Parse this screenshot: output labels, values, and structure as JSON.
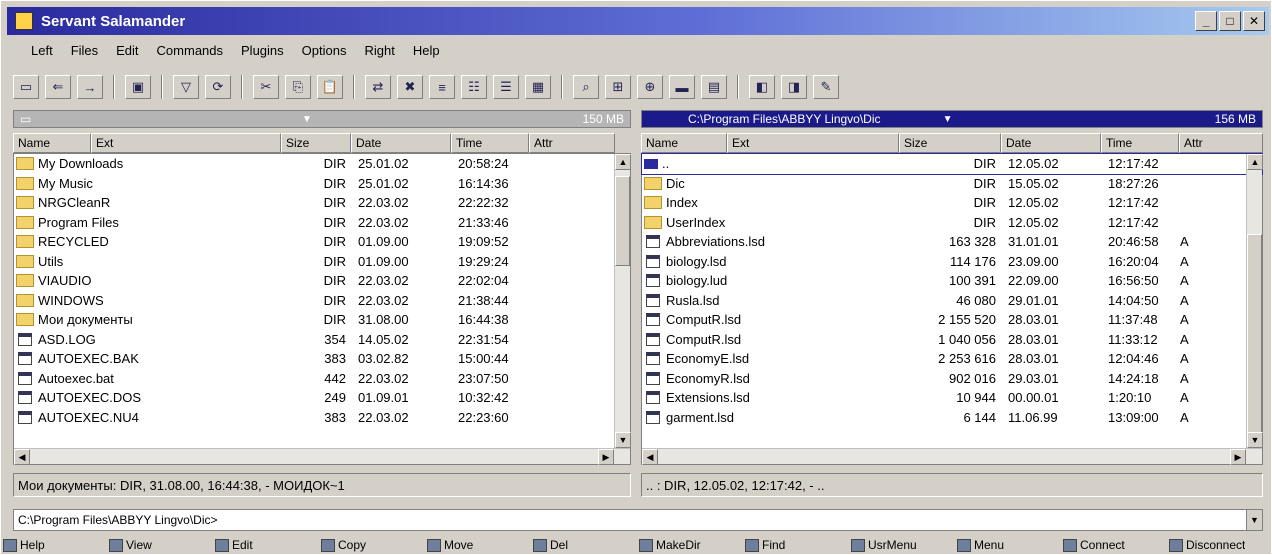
{
  "window": {
    "title": "Servant Salamander"
  },
  "menu": [
    "Left",
    "Files",
    "Edit",
    "Commands",
    "Plugins",
    "Options",
    "Right",
    "Help"
  ],
  "left": {
    "drive_free": "150 MB",
    "columns": [
      "Name",
      "Ext",
      "Size",
      "Date",
      "Time",
      "Attr"
    ],
    "rows": [
      {
        "name": "My Downloads",
        "size": "DIR",
        "date": "25.01.02",
        "time": "20:58:24",
        "attr": "",
        "icon": "folder-open"
      },
      {
        "name": "My Music",
        "size": "DIR",
        "date": "25.01.02",
        "time": "16:14:36",
        "attr": "",
        "icon": "folder"
      },
      {
        "name": "NRGCleanR",
        "size": "DIR",
        "date": "22.03.02",
        "time": "22:22:32",
        "attr": "",
        "icon": "folder"
      },
      {
        "name": "Program Files",
        "size": "DIR",
        "date": "22.03.02",
        "time": "21:33:46",
        "attr": "",
        "icon": "folder"
      },
      {
        "name": "RECYCLED",
        "size": "DIR",
        "date": "01.09.00",
        "time": "19:09:52",
        "attr": "",
        "icon": "recycle"
      },
      {
        "name": "Utils",
        "size": "DIR",
        "date": "01.09.00",
        "time": "19:29:24",
        "attr": "",
        "icon": "folder"
      },
      {
        "name": "VIAUDIO",
        "size": "DIR",
        "date": "22.03.02",
        "time": "22:02:04",
        "attr": "",
        "icon": "folder"
      },
      {
        "name": "WINDOWS",
        "size": "DIR",
        "date": "22.03.02",
        "time": "21:38:44",
        "attr": "",
        "icon": "folder"
      },
      {
        "name": "Мои документы",
        "size": "DIR",
        "date": "31.08.00",
        "time": "16:44:38",
        "attr": "",
        "icon": "folder"
      },
      {
        "name": "ASD.LOG",
        "size": "354",
        "date": "14.05.02",
        "time": "22:31:54",
        "attr": "",
        "icon": "file"
      },
      {
        "name": "AUTOEXEC.BAK",
        "size": "383",
        "date": "03.02.82",
        "time": "15:00:44",
        "attr": "",
        "icon": "file"
      },
      {
        "name": "Autoexec.bat",
        "size": "442",
        "date": "22.03.02",
        "time": "23:07:50",
        "attr": "",
        "icon": "bat"
      },
      {
        "name": "AUTOEXEC.DOS",
        "size": "249",
        "date": "01.09.01",
        "time": "10:32:42",
        "attr": "",
        "icon": "file"
      },
      {
        "name": "AUTOEXEC.NU4",
        "size": "383",
        "date": "22.03.02",
        "time": "22:23:60",
        "attr": "",
        "icon": "file"
      }
    ],
    "status": "Мои документы: DIR, 31.08.00, 16:44:38, - МОИДОК~1"
  },
  "right": {
    "path": "C:\\Program Files\\ABBYY Lingvo\\Dic",
    "drive_free": "156 MB",
    "columns": [
      "Name",
      "Ext",
      "Size",
      "Date",
      "Time",
      "Attr"
    ],
    "rows": [
      {
        "name": "..",
        "size": "DIR",
        "date": "12.05.02",
        "time": "12:17:42",
        "attr": "",
        "icon": "up"
      },
      {
        "name": "Dic",
        "size": "DIR",
        "date": "15.05.02",
        "time": "18:27:26",
        "attr": "",
        "icon": "folder"
      },
      {
        "name": "Index",
        "size": "DIR",
        "date": "12.05.02",
        "time": "12:17:42",
        "attr": "",
        "icon": "folder"
      },
      {
        "name": "UserIndex",
        "size": "DIR",
        "date": "12.05.02",
        "time": "12:17:42",
        "attr": "",
        "icon": "folder"
      },
      {
        "name": "Abbreviations.lsd",
        "size": "163 328",
        "date": "31.01.01",
        "time": "20:46:58",
        "attr": "A",
        "icon": "file"
      },
      {
        "name": "biology.lsd",
        "size": "114 176",
        "date": "23.09.00",
        "time": "16:20:04",
        "attr": "A",
        "icon": "file"
      },
      {
        "name": "biology.lud",
        "size": "100 391",
        "date": "22.09.00",
        "time": "16:56:50",
        "attr": "A",
        "icon": "file"
      },
      {
        "name": "Rusla.lsd",
        "size": "46 080",
        "date": "29.01.01",
        "time": "14:04:50",
        "attr": "A",
        "icon": "file"
      },
      {
        "name": "ComputR.lsd",
        "size": "2 155 520",
        "date": "28.03.01",
        "time": "11:37:48",
        "attr": "A",
        "icon": "file"
      },
      {
        "name": "ComputR.lsd",
        "size": "1 040 056",
        "date": "28.03.01",
        "time": "11:33:12",
        "attr": "A",
        "icon": "file"
      },
      {
        "name": "EconomyE.lsd",
        "size": "2 253 616",
        "date": "28.03.01",
        "time": "12:04:46",
        "attr": "A",
        "icon": "file"
      },
      {
        "name": "EconomyR.lsd",
        "size": "902 016",
        "date": "29.03.01",
        "time": "14:24:18",
        "attr": "A",
        "icon": "file"
      },
      {
        "name": "Extensions.lsd",
        "size": "10 944",
        "date": "00.00.01",
        "time": "1:20:10",
        "attr": "A",
        "icon": "file"
      },
      {
        "name": "garment.lsd",
        "size": "6 144",
        "date": "11.06.99",
        "time": "13:09:00",
        "attr": "A",
        "icon": "file"
      }
    ],
    "status": ".. : DIR, 12.05.02, 12:17:42, - ..",
    "quicksearch": ""
  },
  "pathline": "C:\\Program Files\\ABBYY Lingvo\\Dic>",
  "fkeys": [
    "Help",
    "View",
    "Edit",
    "Copy",
    "Move",
    "Del",
    "MakeDir",
    "Find",
    "UsrMenu",
    "Menu",
    "Connect",
    "Disconnect"
  ]
}
